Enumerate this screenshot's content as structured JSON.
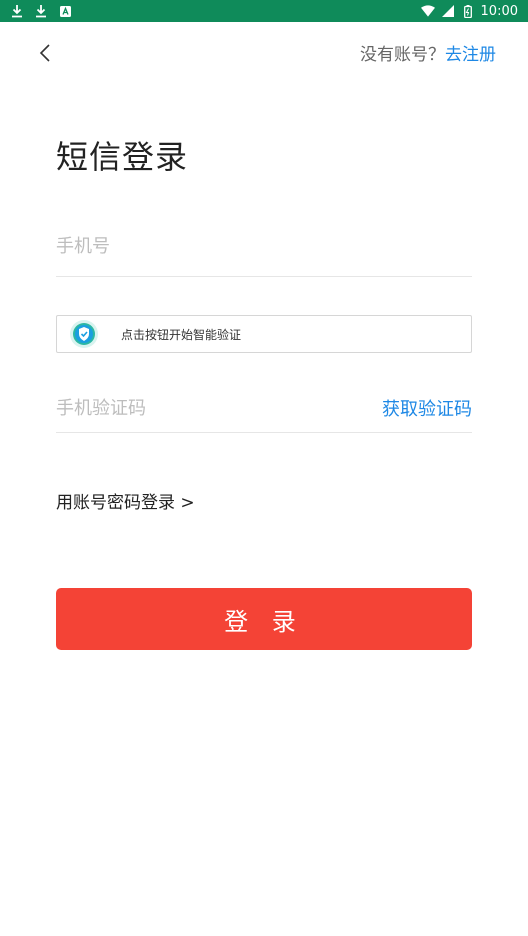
{
  "status_bar": {
    "time": "10:00"
  },
  "header": {
    "no_account_text": "没有账号？",
    "register_link": "去注册"
  },
  "title": "短信登录",
  "phone_field": {
    "placeholder": "手机号",
    "value": ""
  },
  "captcha": {
    "text": "点击按钮开始智能验证"
  },
  "code_field": {
    "placeholder": "手机验证码",
    "value": ""
  },
  "get_code_label": "获取验证码",
  "password_login_link": "用账号密码登录 >",
  "login_button": "登 录",
  "colors": {
    "accent": "#1e88e5",
    "button": "#f44336",
    "status_bar": "#0f8b5a"
  }
}
